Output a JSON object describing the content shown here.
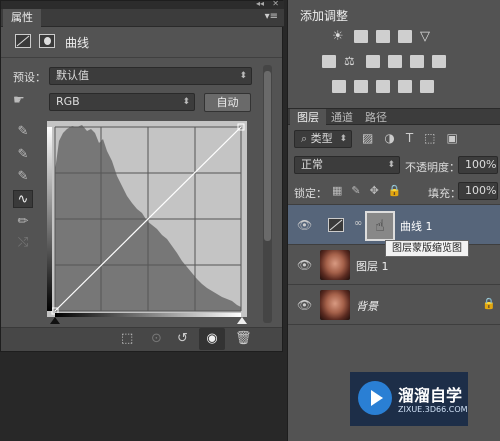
{
  "properties": {
    "tab_label": "属性",
    "header_title": "曲线",
    "preset_label": "预设：",
    "preset_value": "默认值",
    "channel_value": "RGB",
    "auto_label": "自动"
  },
  "adjustments": {
    "title": "添加调整"
  },
  "layers": {
    "tabs": [
      "图层",
      "通道",
      "路径"
    ],
    "filter_label": "类型",
    "blend_mode": "正常",
    "opacity_label": "不透明度：",
    "opacity_value": "100%",
    "lock_label": "锁定：",
    "fill_label": "填充：",
    "fill_value": "100%",
    "items": [
      {
        "name": "曲线 1",
        "selected": true
      },
      {
        "name": "图层 1",
        "selected": false
      },
      {
        "name": "背景",
        "selected": false
      }
    ],
    "tooltip": "图层蒙版缩览图"
  },
  "watermark": {
    "title": "溜溜自学",
    "url": "ZIXUE.3D66.COM"
  },
  "colors": {
    "panel_bg": "#535353",
    "selected_row": "#56657a",
    "watermark_accent": "#2a7fd4"
  }
}
